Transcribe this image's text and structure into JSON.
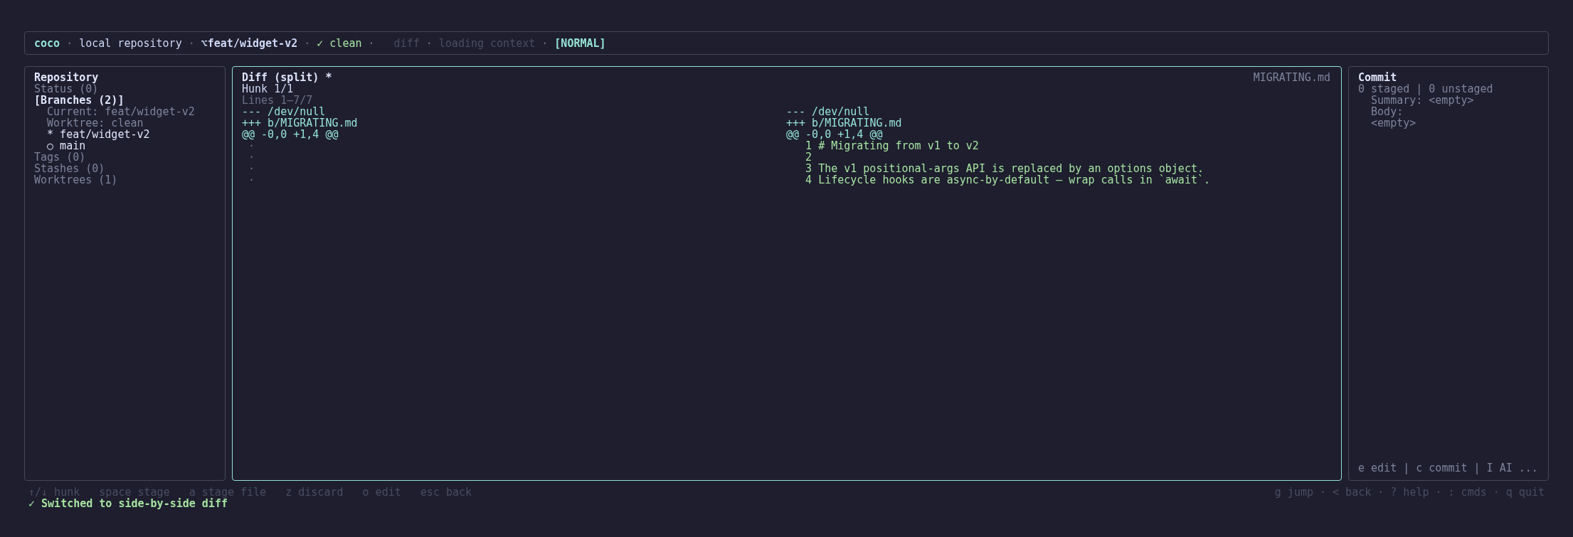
{
  "header": {
    "separator": "·",
    "context": [
      {
        "kind": "app",
        "text": "coco"
      },
      {
        "kind": "repo",
        "text": "local repository"
      },
      {
        "kind": "branch",
        "text": "⌥feat/widget-v2"
      },
      {
        "kind": "state",
        "text": "✓ clean"
      }
    ],
    "activity": [
      "diff",
      "loading context"
    ],
    "mode": "[NORMAL]"
  },
  "sidebar": {
    "focused": false,
    "title": "Repository",
    "items": [
      {
        "label": "Status (0)",
        "selected": false
      },
      {
        "label": "[Branches (2)]",
        "selected": true,
        "details": [
          "Current: feat/widget-v2",
          "Worktree: clean"
        ],
        "children": [
          {
            "label": "* feat/widget-v2"
          },
          {
            "label": "○ main"
          }
        ]
      },
      {
        "label": "Tags (0)",
        "selected": false
      },
      {
        "label": "Stashes (0)",
        "selected": false
      },
      {
        "label": "Worktrees (1)",
        "selected": false
      }
    ]
  },
  "diff": {
    "focused": true,
    "title": "Diff (split) *",
    "file": "MIGRATING.md",
    "hunk": "Hunk 1/1",
    "lines": "Lines 1–7/7",
    "columns": [
      {
        "header": [
          "--- /dev/null",
          "+++ b/MIGRATING.md",
          "@@ -0,0 +1,4 @@"
        ],
        "rows": [
          {
            "kind": "blank",
            "marker": "·"
          },
          {
            "kind": "blank",
            "marker": "·"
          },
          {
            "kind": "blank",
            "marker": "·"
          },
          {
            "kind": "blank",
            "marker": "·"
          }
        ]
      },
      {
        "header": [
          "--- /dev/null",
          "+++ b/MIGRATING.md",
          "@@ -0,0 +1,4 @@"
        ],
        "rows": [
          {
            "kind": "added",
            "number": "1",
            "text": "# Migrating from v1 to v2"
          },
          {
            "kind": "added",
            "number": "2"
          },
          {
            "kind": "added",
            "number": "3",
            "text": "The v1 positional-args API is replaced by an options object."
          },
          {
            "kind": "added",
            "number": "4",
            "text": "Lifecycle hooks are async-by-default — wrap calls in `await`."
          }
        ]
      }
    ]
  },
  "commit": {
    "focused": false,
    "title": "Commit",
    "counts": "0 staged | 0 unstaged",
    "fields": [
      {
        "kind": "inline",
        "label": "Summary:",
        "value": "<empty>"
      },
      {
        "kind": "block",
        "label": "Body:",
        "value": "<empty>"
      }
    ],
    "footer": "e edit | c commit | I AI ..."
  },
  "footer": {
    "separator": "·",
    "hints": [
      "↑/↓ hunk",
      "space stage",
      "a stage file",
      "z discard",
      "o edit",
      "esc back"
    ],
    "shortcuts": [
      "g jump",
      "< back",
      "? help",
      ": cmds",
      "q quit"
    ],
    "message": "✓ Switched to side-by-side diff"
  }
}
